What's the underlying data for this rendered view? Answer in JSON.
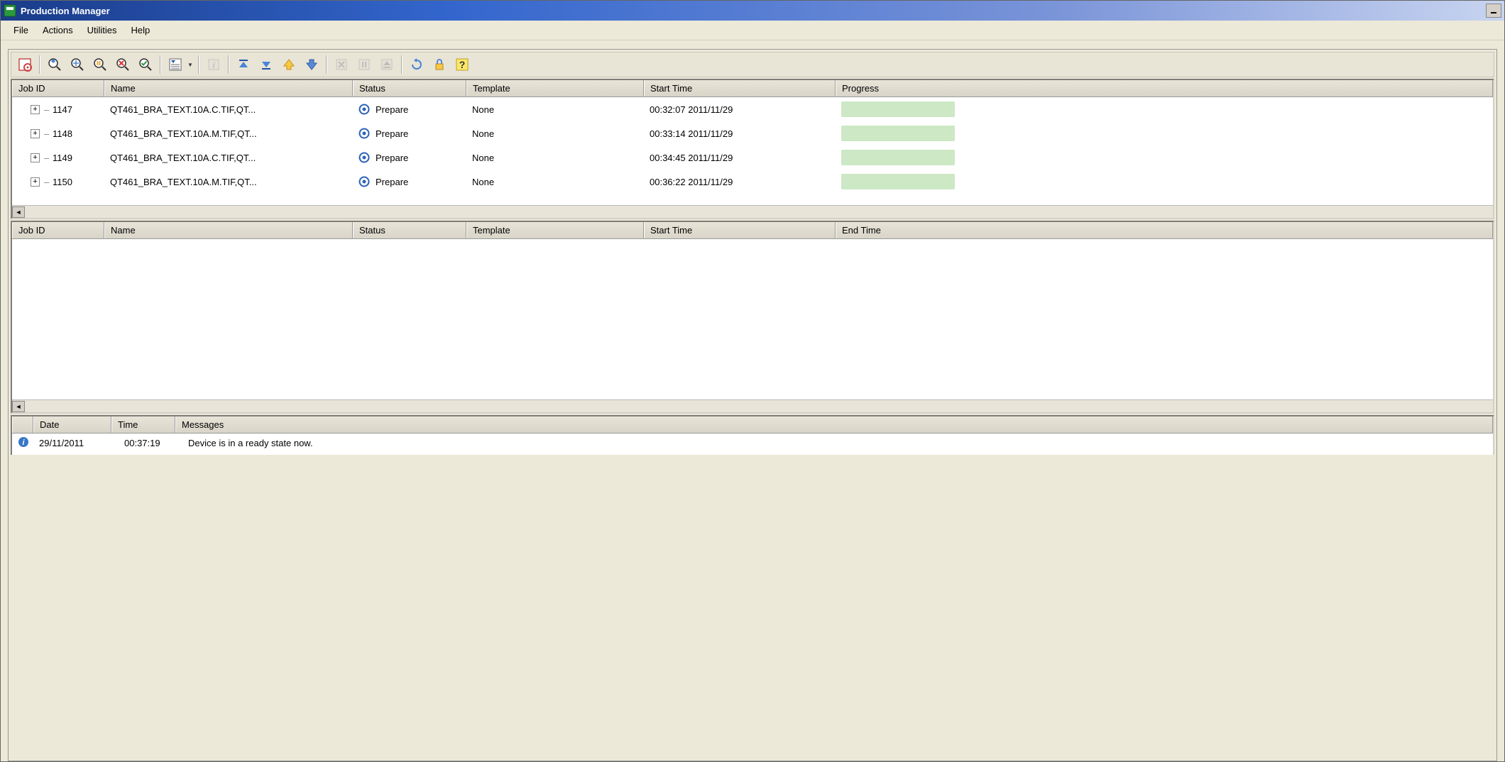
{
  "window": {
    "title": "Production Manager"
  },
  "menu": {
    "file": "File",
    "actions": "Actions",
    "utilities": "Utilities",
    "help": "Help"
  },
  "jobs_pane": {
    "headers": {
      "job_id": "Job ID",
      "name": "Name",
      "status": "Status",
      "template": "Template",
      "start_time": "Start Time",
      "progress": "Progress"
    },
    "rows": [
      {
        "job_id": "1147",
        "name": "QT461_BRA_TEXT.10A.C.TIF,QT...",
        "status": "Prepare",
        "template": "None",
        "start_time": "00:32:07 2011/11/29"
      },
      {
        "job_id": "1148",
        "name": "QT461_BRA_TEXT.10A.M.TIF,QT...",
        "status": "Prepare",
        "template": "None",
        "start_time": "00:33:14 2011/11/29"
      },
      {
        "job_id": "1149",
        "name": "QT461_BRA_TEXT.10A.C.TIF,QT...",
        "status": "Prepare",
        "template": "None",
        "start_time": "00:34:45 2011/11/29"
      },
      {
        "job_id": "1150",
        "name": "QT461_BRA_TEXT.10A.M.TIF,QT...",
        "status": "Prepare",
        "template": "None",
        "start_time": "00:36:22 2011/11/29"
      }
    ]
  },
  "history_pane": {
    "headers": {
      "job_id": "Job ID",
      "name": "Name",
      "status": "Status",
      "template": "Template",
      "start_time": "Start Time",
      "end_time": "End Time"
    }
  },
  "messages_pane": {
    "headers": {
      "date": "Date",
      "time": "Time",
      "messages": "Messages"
    },
    "rows": [
      {
        "date": "29/11/2011",
        "time": "00:37:19",
        "message": "Device is in a ready state now."
      }
    ]
  }
}
